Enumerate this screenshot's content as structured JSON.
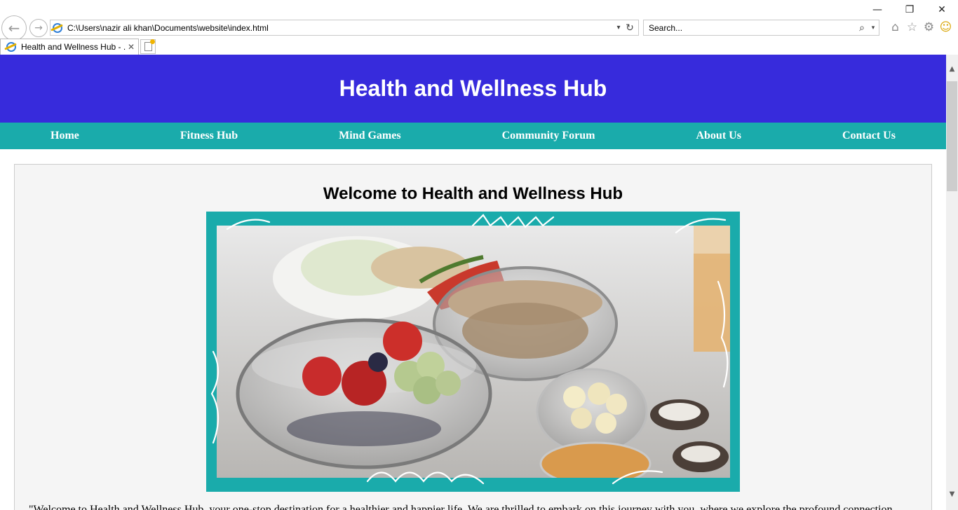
{
  "browser": {
    "window_controls": {
      "minimize": "—",
      "restore": "❐",
      "close": "✕"
    },
    "address_url": "C:\\Users\\nazir ali khan\\Documents\\website\\index.html",
    "search_placeholder": "Search...",
    "tab_title": "Health and Wellness Hub - ...",
    "tab_close": "✕",
    "nav_back_glyph": "←",
    "nav_forward_glyph": "→",
    "addr_dropdown_glyph": "▾",
    "addr_refresh_glyph": "↻",
    "search_glass_glyph": "⌕",
    "search_dropdown_glyph": "▾",
    "tool_icons": {
      "home": "⌂",
      "favorites": "☆",
      "settings": "⚙",
      "feedback": "☺"
    },
    "icons": [
      "back-icon",
      "forward-icon",
      "ie-page-icon",
      "refresh-icon",
      "search-icon",
      "home-icon",
      "favorites-star-icon",
      "settings-gear-icon",
      "smiley-feedback-icon",
      "new-tab-icon"
    ]
  },
  "page": {
    "site_title": "Health and Wellness Hub",
    "nav": [
      "Home",
      "Fitness Hub",
      "Mind Games",
      "Community Forum",
      "About Us",
      "Contact Us"
    ],
    "welcome_heading": "Welcome to Health and Wellness Hub",
    "intro_text": "\"Welcome to Health and Wellness Hub, your one-stop destination for a healthier and happier life. We are thrilled to embark on this journey with you, where we explore the profound connection",
    "colors": {
      "header_bg": "#372bdc",
      "nav_bg": "#1aabab",
      "content_bg": "#f5f5f5",
      "frame_bg": "#1aabab"
    }
  },
  "scrollbar": {
    "up_glyph": "▲",
    "down_glyph": "▼"
  }
}
